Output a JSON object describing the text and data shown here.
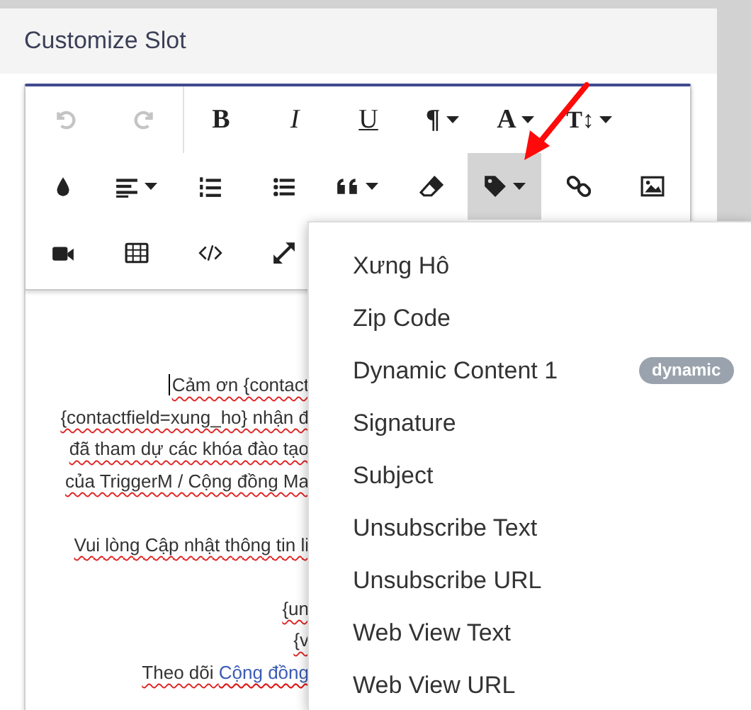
{
  "panel": {
    "title": "Customize Slot"
  },
  "toolbar": {
    "rows": [
      [
        {
          "kind": "undo",
          "disabled": true,
          "selected": false
        },
        {
          "kind": "redo",
          "disabled": true,
          "selected": false
        },
        {
          "kind": "bold",
          "label": "B",
          "disabled": false,
          "selected": false
        },
        {
          "kind": "italic",
          "label": "I",
          "disabled": false,
          "selected": false
        },
        {
          "kind": "underline",
          "label": "U",
          "disabled": false,
          "selected": false
        },
        {
          "kind": "paragraph",
          "label": "¶",
          "caret": true,
          "disabled": false,
          "selected": false
        },
        {
          "kind": "font",
          "label": "A",
          "caret": true,
          "disabled": false,
          "selected": false
        },
        {
          "kind": "size",
          "label": "T↕",
          "caret": true,
          "disabled": false,
          "selected": false
        }
      ],
      [
        {
          "kind": "color",
          "disabled": false,
          "selected": false
        },
        {
          "kind": "align",
          "caret": true,
          "disabled": false,
          "selected": false
        },
        {
          "kind": "ordered-list",
          "disabled": false,
          "selected": false
        },
        {
          "kind": "bullet-list",
          "disabled": false,
          "selected": false
        },
        {
          "kind": "quote",
          "caret": true,
          "disabled": false,
          "selected": false
        },
        {
          "kind": "eraser",
          "disabled": false,
          "selected": false
        },
        {
          "kind": "tag",
          "caret": true,
          "disabled": false,
          "selected": true
        },
        {
          "kind": "link",
          "disabled": false,
          "selected": false
        },
        {
          "kind": "image",
          "disabled": false,
          "selected": false
        }
      ],
      [
        {
          "kind": "video",
          "disabled": false,
          "selected": false
        },
        {
          "kind": "table",
          "disabled": false,
          "selected": false
        },
        {
          "kind": "code",
          "disabled": false,
          "selected": false
        },
        {
          "kind": "expand",
          "disabled": false,
          "selected": false
        }
      ]
    ]
  },
  "content": {
    "lines": [
      {
        "text": "Cảm ơn {contact",
        "cursor": true
      },
      {
        "text": "{contactfield=xung_ho} nhận đ",
        "cursor": false
      },
      {
        "text": "đã tham dự các khóa đào tạo",
        "cursor": false
      },
      {
        "text": "của TriggerM / Cộng đồng Ma",
        "cursor": false
      },
      {
        "kind": "blank"
      },
      {
        "text": "Vui lòng Cập nhật thông tin li",
        "cursor": false
      },
      {
        "kind": "blank"
      },
      {
        "text": "{un",
        "cursor": false
      },
      {
        "text": "{v",
        "cursor": false
      },
      {
        "text": "Theo dõi ",
        "link": "Cộng đồng",
        "cursor": false
      }
    ]
  },
  "dropdown": {
    "items": [
      {
        "label": "Xưng Hô"
      },
      {
        "label": "Zip Code"
      },
      {
        "label": "Dynamic Content 1",
        "badge": "dynamic"
      },
      {
        "label": "Signature"
      },
      {
        "label": "Subject"
      },
      {
        "label": "Unsubscribe Text"
      },
      {
        "label": "Unsubscribe URL"
      },
      {
        "label": "Web View Text"
      },
      {
        "label": "Web View URL"
      }
    ]
  }
}
